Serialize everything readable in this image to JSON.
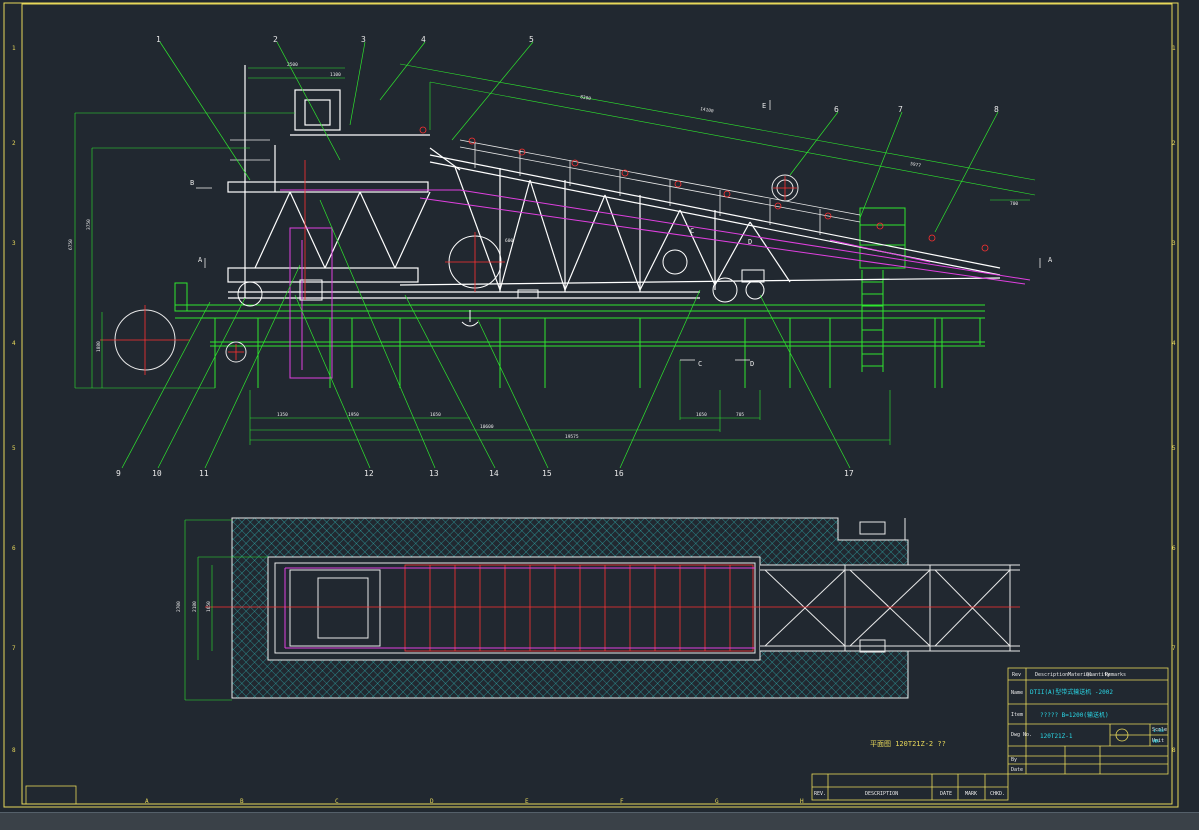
{
  "drawing": {
    "balloons": [
      "1",
      "2",
      "3",
      "4",
      "5",
      "6",
      "7",
      "8",
      "9",
      "10",
      "11",
      "12",
      "13",
      "14",
      "15",
      "16",
      "17"
    ],
    "section_marks": {
      "a_left": "A",
      "a_right": "A",
      "b": "B",
      "c_top": "C",
      "c_bottom": "C",
      "d_top": "D",
      "d_bottom": "D",
      "e": "E"
    },
    "dimensions": {
      "d_2500": "2500",
      "d_1100": "1100",
      "d_8300": "8300",
      "d_14100": "14100",
      "d_5977": "5977",
      "d_700": "700",
      "d_1350": "1350",
      "d_1950": "1950",
      "d_1650": "1650",
      "d_1650b": "1650",
      "d_705": "705",
      "d_10600": "10600",
      "d_19575": "19575",
      "d_6750": "6750",
      "d_3750": "3750",
      "d_1880": "1880",
      "d_2700": "2700",
      "d_2180": "2180",
      "d_1650v": "1650",
      "d_600": "600"
    },
    "plan_caption": "平面图 120T21Z-2 ??"
  },
  "title_block": {
    "rev_headers": [
      "Rev",
      "Description",
      "Material",
      "Quantity",
      "Remarks"
    ],
    "name_label": "Name",
    "name_value": "DTII(A)型带式输送机 -2002",
    "item_label": "Item",
    "item_value": "????? B=1200(输送机)",
    "dwg_label": "Dwg No.",
    "dwg_value": "120T21Z-1",
    "scale_label": "Scale",
    "scale_value": "1:30",
    "unit_label": "Unit",
    "unit_value": "MM",
    "by_label": "By",
    "date_label": "Date",
    "bottom_headers": [
      "REV.",
      "DESCRIPTION",
      "DATE",
      "MARK",
      "CHKD."
    ]
  },
  "frame": {
    "col_labels": [
      "A",
      "B",
      "C",
      "D",
      "E",
      "F",
      "G",
      "H"
    ],
    "row_labels": [
      "1",
      "2",
      "3",
      "4",
      "5",
      "6",
      "7",
      "8"
    ]
  }
}
